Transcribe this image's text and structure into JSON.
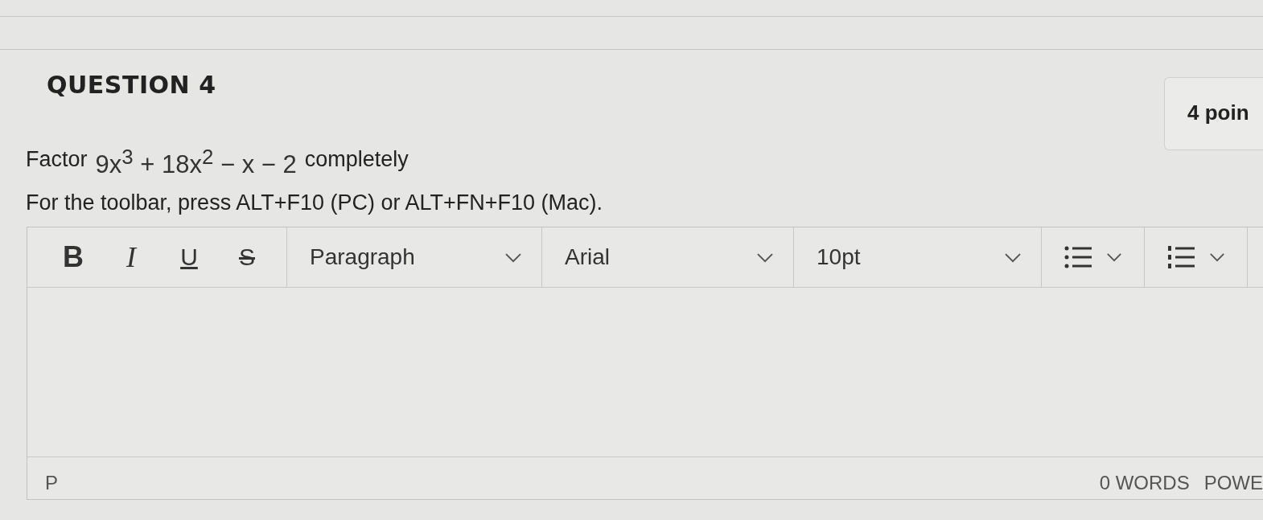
{
  "question": {
    "title": "QUESTION 4",
    "points": "4 poin"
  },
  "prompt": {
    "lead": "Factor",
    "math": "9x$^{3}$ + 18x$^{2}$ − x − 2",
    "tail": "completely"
  },
  "hint": "For the toolbar, press ALT+F10 (PC) or ALT+FN+F10 (Mac).",
  "toolbar": {
    "format_buttons": [
      {
        "label": "B",
        "kind": "bold"
      },
      {
        "label": "I",
        "kind": "italic"
      },
      {
        "label": "U",
        "kind": "underline"
      },
      {
        "label": "S",
        "kind": "strike"
      }
    ],
    "dropdowns": [
      {
        "value": "Paragraph"
      },
      {
        "value": "Arial"
      },
      {
        "value": "10pt"
      }
    ],
    "list_buttons": [
      {
        "kind": "bullet"
      },
      {
        "kind": "numbered"
      }
    ]
  },
  "status_bar": {
    "path": "P",
    "word_count": "0 WORDS",
    "brand": "POWE"
  }
}
